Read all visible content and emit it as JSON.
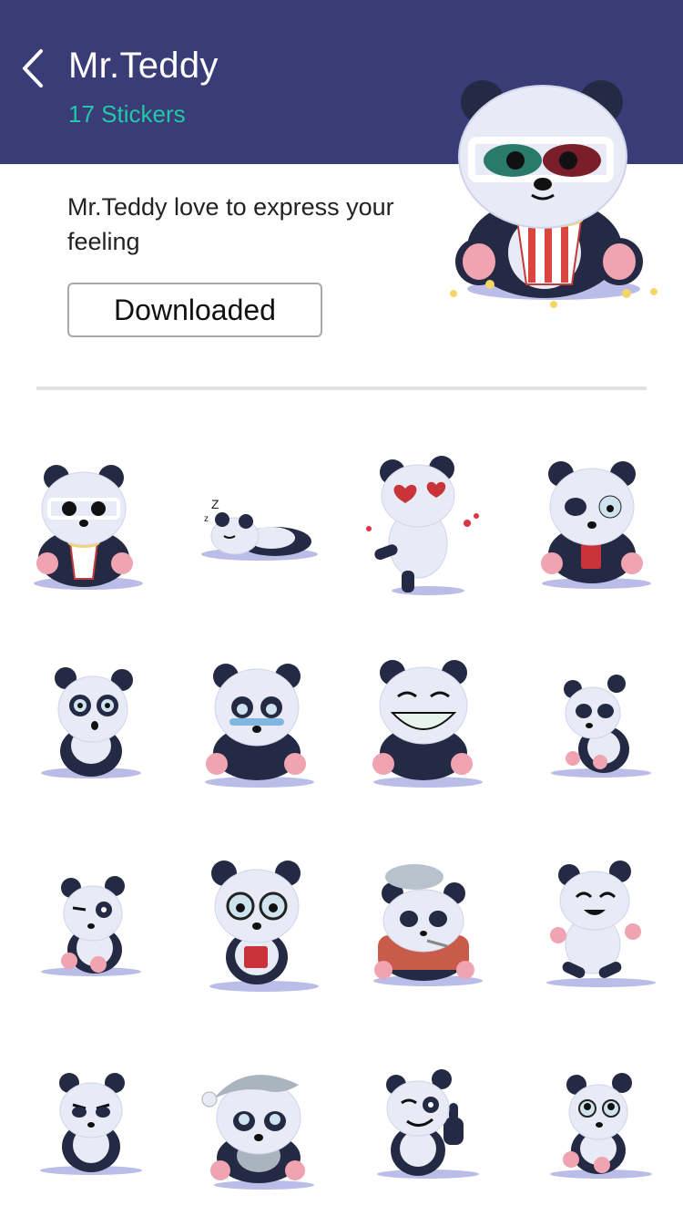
{
  "header": {
    "title": "Mr.Teddy",
    "subtitle": "17 Stickers",
    "background": "#393c77",
    "accent": "#22c9a6",
    "back_icon": "chevron-left-icon"
  },
  "description": "Mr.Teddy love to express your feeling",
  "download_button": {
    "label": "Downloaded"
  },
  "hero_sticker": {
    "pose": "popcorn-3d-glasses"
  },
  "stickers": [
    {
      "pose": "popcorn-3d-glasses"
    },
    {
      "pose": "sleeping"
    },
    {
      "pose": "in-love-dancing"
    },
    {
      "pose": "coffee-tired"
    },
    {
      "pose": "surprised"
    },
    {
      "pose": "crying"
    },
    {
      "pose": "big-grin"
    },
    {
      "pose": "sad-sideways"
    },
    {
      "pose": "winking-sitting"
    },
    {
      "pose": "glasses-coffee"
    },
    {
      "pose": "sick-scarf"
    },
    {
      "pose": "happy-jumping"
    },
    {
      "pose": "angry"
    },
    {
      "pose": "sleepy-nightcap"
    },
    {
      "pose": "thumbs-up"
    },
    {
      "pose": "hopeful"
    }
  ]
}
